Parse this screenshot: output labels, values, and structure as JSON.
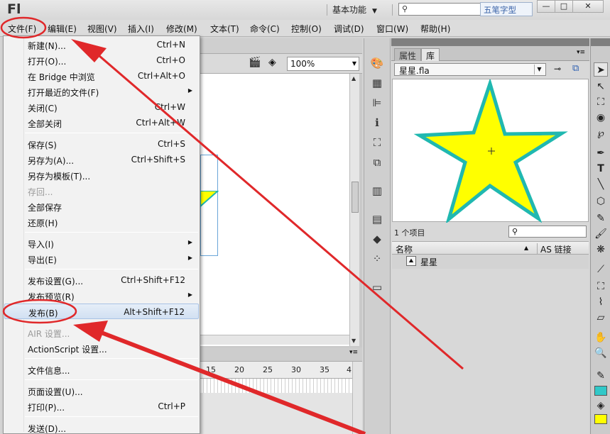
{
  "app": {
    "logo": "Fl"
  },
  "titlebar": {
    "workspace_label": "基本功能",
    "search_placeholder": "",
    "watermark": "五笔字型",
    "minimize": "—",
    "maximize": "□",
    "close": "✕"
  },
  "menubar": {
    "items": [
      "文件(F)",
      "编辑(E)",
      "视图(V)",
      "插入(I)",
      "修改(M)",
      "文本(T)",
      "命令(C)",
      "控制(O)",
      "调试(D)",
      "窗口(W)",
      "帮助(H)"
    ]
  },
  "file_menu": {
    "items": [
      {
        "label": "新建(N)...",
        "shortcut": "Ctrl+N"
      },
      {
        "label": "打开(O)...",
        "shortcut": "Ctrl+O"
      },
      {
        "label": "在 Bridge 中浏览",
        "shortcut": "Ctrl+Alt+O"
      },
      {
        "label": "打开最近的文件(F)",
        "shortcut": ""
      },
      {
        "label": "关闭(C)",
        "shortcut": "Ctrl+W"
      },
      {
        "label": "全部关闭",
        "shortcut": "Ctrl+Alt+W"
      },
      {
        "label": "保存(S)",
        "shortcut": "Ctrl+S"
      },
      {
        "label": "另存为(A)...",
        "shortcut": "Ctrl+Shift+S"
      },
      {
        "label": "另存为模板(T)...",
        "shortcut": ""
      },
      {
        "label": "存回...",
        "shortcut": ""
      },
      {
        "label": "全部保存",
        "shortcut": ""
      },
      {
        "label": "还原(H)",
        "shortcut": ""
      },
      {
        "label": "导入(I)",
        "shortcut": ""
      },
      {
        "label": "导出(E)",
        "shortcut": ""
      },
      {
        "label": "发布设置(G)...",
        "shortcut": "Ctrl+Shift+F12"
      },
      {
        "label": "发布预览(R)",
        "shortcut": ""
      },
      {
        "label": "发布(B)",
        "shortcut": "Alt+Shift+F12"
      },
      {
        "label": "AIR 设置...",
        "shortcut": ""
      },
      {
        "label": "ActionScript 设置...",
        "shortcut": ""
      },
      {
        "label": "文件信息...",
        "shortcut": ""
      },
      {
        "label": "页面设置(U)...",
        "shortcut": ""
      },
      {
        "label": "打印(P)...",
        "shortcut": "Ctrl+P"
      },
      {
        "label": "发送(D)...",
        "shortcut": ""
      }
    ]
  },
  "document": {
    "zoom": "100%",
    "timeline_ruler": [
      "15",
      "20",
      "25",
      "30",
      "35",
      "4"
    ]
  },
  "library_panel": {
    "tabs": [
      "属性",
      "库"
    ],
    "active_tab": "库",
    "document_name": "星星.fla",
    "item_count": "1 个项目",
    "columns": {
      "name": "名称",
      "linkage": "AS 链接"
    },
    "items": [
      {
        "name": "星星"
      }
    ]
  },
  "colors": {
    "star_fill": "#ffff00",
    "star_stroke": "#20b8b0",
    "stroke_swatch": "#30c8c8",
    "fill_swatch": "#ffff00",
    "annotation_red": "#e0282a"
  }
}
